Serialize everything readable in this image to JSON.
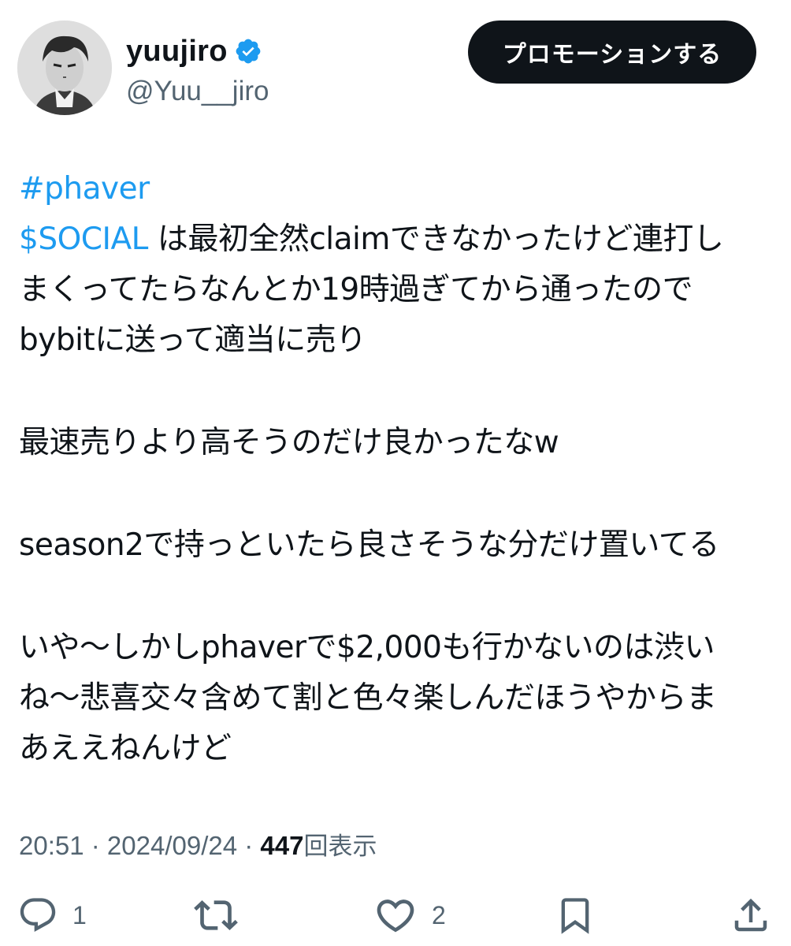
{
  "author": {
    "display_name": "yuujiro",
    "handle": "@Yuu__jiro",
    "verified": true
  },
  "promote_button": {
    "label": "プロモーションする"
  },
  "tweet": {
    "hashtag": "#phaver",
    "cashtag": "$SOCIAL",
    "line1_rest": " は最初全然claimできなかったけど連打し",
    "line2": "まくってたらなんとか19時過ぎてから通ったので",
    "line3": "bybitに送って適当に売り",
    "line4": "最速売りより高そうのだけ良かったなw",
    "line5": "season2で持っといたら良さそうな分だけ置いてる",
    "line6": "いや〜しかしphaverで$2,000も行かないのは渋い",
    "line7": "ね〜悲喜交々含めて割と色々楽しんだほうやからま",
    "line8": "あええねんけど"
  },
  "meta": {
    "time": "20:51",
    "separator": " · ",
    "date": "2024/09/24",
    "views_count": "447",
    "views_label": "回表示"
  },
  "actions": {
    "reply_count": "1",
    "like_count": "2"
  },
  "colors": {
    "link": "#1d9bf0",
    "text": "#0f1419",
    "secondary": "#536471",
    "button_bg": "#0f1419"
  },
  "icons": {
    "verified": "verified-badge-icon",
    "reply": "reply-icon",
    "retweet": "retweet-icon",
    "like": "heart-icon",
    "bookmark": "bookmark-icon",
    "share": "share-icon"
  }
}
